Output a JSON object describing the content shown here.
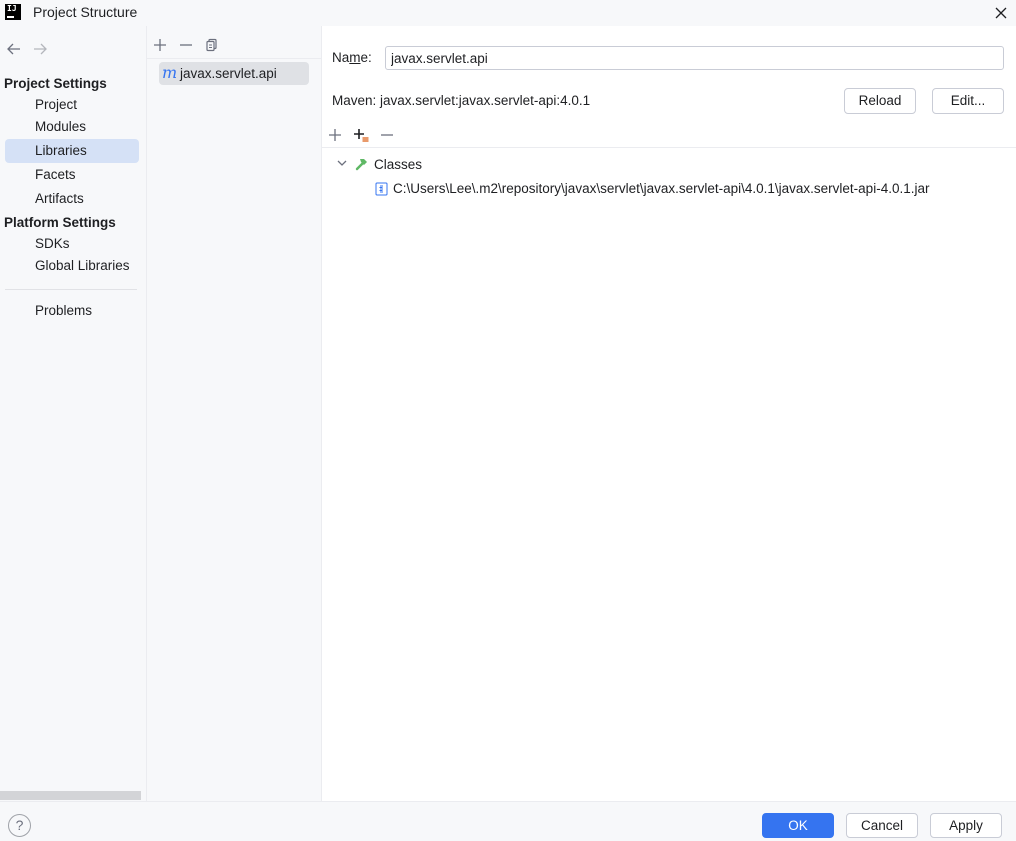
{
  "window": {
    "title": "Project Structure",
    "logo_text": "IJ"
  },
  "nav": {
    "project_settings_header": "Project Settings",
    "project_settings_items": [
      {
        "label": "Project",
        "selected": false
      },
      {
        "label": "Modules",
        "selected": false
      },
      {
        "label": "Libraries",
        "selected": true
      },
      {
        "label": "Facets",
        "selected": false
      },
      {
        "label": "Artifacts",
        "selected": false
      }
    ],
    "platform_settings_header": "Platform Settings",
    "platform_settings_items": [
      {
        "label": "SDKs"
      },
      {
        "label": "Global Libraries"
      }
    ],
    "problems_label": "Problems"
  },
  "libraries": {
    "items": [
      {
        "icon": "maven-library-icon",
        "icon_glyph": "m",
        "label": "javax.servlet.api",
        "selected": true
      }
    ]
  },
  "detail": {
    "name_label_pre": "Na",
    "name_label_mnemonic": "m",
    "name_label_post": "e:",
    "name_value": "javax.servlet.api",
    "maven_label": "Maven: javax.servlet:javax.servlet-api:4.0.1",
    "reload_label": "Reload",
    "edit_label": "Edit...",
    "tree": {
      "classes_label": "Classes",
      "jar_path": "C:\\Users\\Lee\\.m2\\repository\\javax\\servlet\\javax.servlet-api\\4.0.1\\javax.servlet-api-4.0.1.jar"
    }
  },
  "footer": {
    "help_label": "?",
    "ok_label": "OK",
    "cancel_label": "Cancel",
    "apply_label": "Apply"
  },
  "colors": {
    "accent": "#3574f0",
    "selection": "#d5e1f6",
    "list_selection": "#dfe1e5",
    "hammer": "#5fb865"
  }
}
